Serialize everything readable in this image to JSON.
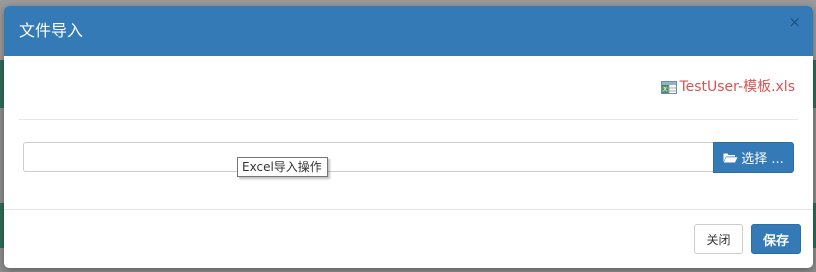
{
  "modal": {
    "title": "文件导入",
    "close_symbol": "×"
  },
  "template": {
    "icon": "excel-file-icon",
    "label": "TestUser-模板.xls"
  },
  "file_picker": {
    "value": "",
    "button_icon": "folder-open-icon",
    "button_label": "选择 ..."
  },
  "tooltip": {
    "text": "Excel导入操作"
  },
  "footer": {
    "close_label": "关闭",
    "save_label": "保存"
  },
  "colors": {
    "header": "#337ab7",
    "link": "#d9534f",
    "primary": "#337ab7"
  }
}
